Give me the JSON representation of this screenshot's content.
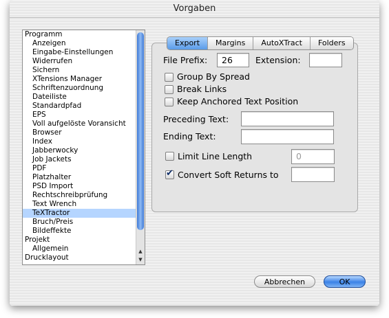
{
  "window": {
    "title": "Vorgaben"
  },
  "sidebar": {
    "items": [
      {
        "label": "Programm",
        "level": 0
      },
      {
        "label": "Anzeigen",
        "level": 1
      },
      {
        "label": "Eingabe-Einstellungen",
        "level": 1
      },
      {
        "label": "Widerrufen",
        "level": 1
      },
      {
        "label": "Sichern",
        "level": 1
      },
      {
        "label": "XTensions Manager",
        "level": 1
      },
      {
        "label": "Schriftenzuordnung",
        "level": 1
      },
      {
        "label": "Dateiliste",
        "level": 1
      },
      {
        "label": "Standardpfad",
        "level": 1
      },
      {
        "label": "EPS",
        "level": 1
      },
      {
        "label": "Voll aufgelöste Voransicht",
        "level": 1
      },
      {
        "label": "Browser",
        "level": 1
      },
      {
        "label": "Index",
        "level": 1
      },
      {
        "label": "Jabberwocky",
        "level": 1
      },
      {
        "label": "Job Jackets",
        "level": 1
      },
      {
        "label": "PDF",
        "level": 1
      },
      {
        "label": "Platzhalter",
        "level": 1
      },
      {
        "label": "PSD Import",
        "level": 1
      },
      {
        "label": "Rechtschreibprüfung",
        "level": 1
      },
      {
        "label": "Text Wrench",
        "level": 1
      },
      {
        "label": "TeXTractor",
        "level": 1,
        "selected": true
      },
      {
        "label": "Bruch/Preis",
        "level": 1
      },
      {
        "label": "Bildeffekte",
        "level": 1
      },
      {
        "label": "Projekt",
        "level": 0
      },
      {
        "label": "Allgemein",
        "level": 1
      },
      {
        "label": "Drucklayout",
        "level": 0
      }
    ]
  },
  "tabs": [
    {
      "label": "Export",
      "active": true
    },
    {
      "label": "Margins",
      "active": false
    },
    {
      "label": "AutoXTract",
      "active": false
    },
    {
      "label": "Folders",
      "active": false
    }
  ],
  "form": {
    "file_prefix_label": "File Prefix:",
    "file_prefix_value": "26",
    "extension_label": "Extension:",
    "extension_value": "",
    "group_by_spread_label": "Group By Spread",
    "group_by_spread_checked": false,
    "break_links_label": "Break Links",
    "break_links_checked": false,
    "keep_anchored_label": "Keep Anchored Text Position",
    "keep_anchored_checked": false,
    "preceding_text_label": "Preceding Text:",
    "preceding_text_value": "",
    "ending_text_label": "Ending Text:",
    "ending_text_value": "",
    "limit_line_length_label": "Limit Line Length",
    "limit_line_length_checked": false,
    "limit_line_length_value": "0",
    "convert_soft_returns_label": "Convert Soft Returns to",
    "convert_soft_returns_checked": true,
    "convert_soft_returns_value": ""
  },
  "buttons": {
    "cancel_label": "Abbrechen",
    "ok_label": "OK"
  }
}
